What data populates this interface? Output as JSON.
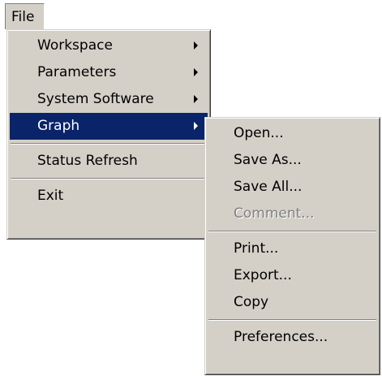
{
  "menubar": {
    "file_label": "File"
  },
  "file_menu": {
    "workspace": "Workspace",
    "parameters": "Parameters",
    "system_software": "System Software",
    "graph": "Graph",
    "status_refresh": "Status Refresh",
    "exit": "Exit"
  },
  "graph_menu": {
    "open": "Open...",
    "save_as": "Save As...",
    "save_all": "Save All...",
    "comment": "Comment...",
    "print": "Print...",
    "export": "Export...",
    "copy": "Copy",
    "preferences": "Preferences..."
  },
  "colors": {
    "menu_bg": "#d4d0c8",
    "highlight": "#0a246a",
    "disabled_text": "#808080"
  }
}
